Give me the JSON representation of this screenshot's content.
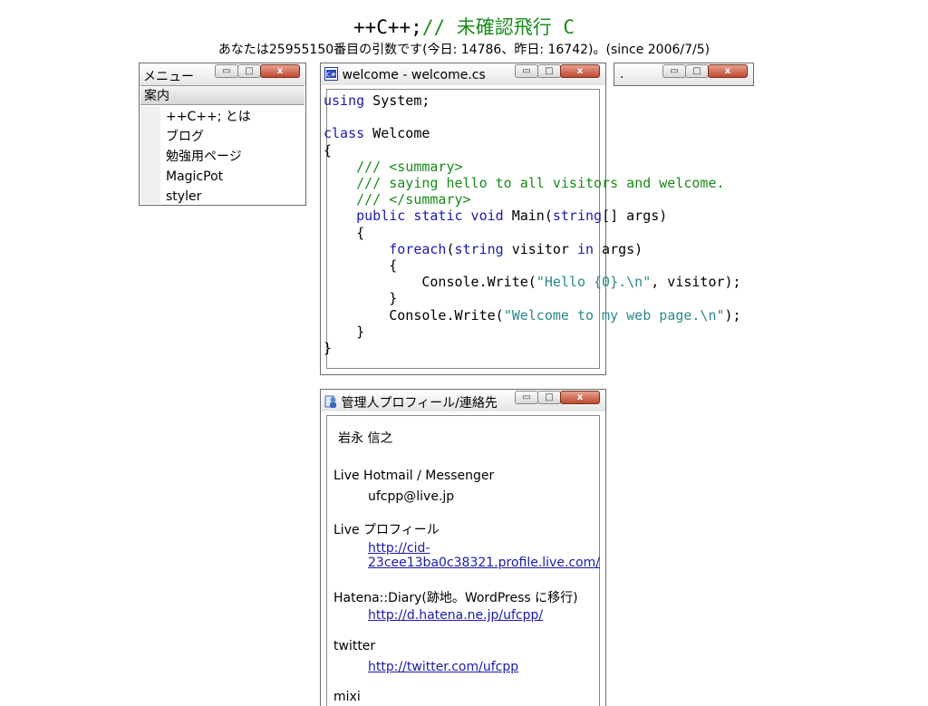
{
  "header": {
    "title_code": "++C++;",
    "title_comment": "// 未確認飛行 C",
    "counter": "あなたは25955150番目の引数です(今日: 14786、昨日: 16742)。(since 2006/7/5)"
  },
  "menu_window": {
    "title": "メニュー",
    "section": "案内",
    "items": [
      "++C++; とは",
      "ブログ",
      "勉強用ページ",
      "MagicPot",
      "styler"
    ]
  },
  "welcome_window": {
    "title": "welcome - welcome.cs",
    "code": [
      [
        [
          "kw",
          "using"
        ],
        [
          "tx",
          " System;"
        ]
      ],
      [],
      [
        [
          "kw",
          "class"
        ],
        [
          "tx",
          " Welcome"
        ]
      ],
      [
        [
          "tx",
          "{"
        ]
      ],
      [
        [
          "tx",
          "    "
        ],
        [
          "cm",
          "/// <summary>"
        ]
      ],
      [
        [
          "tx",
          "    "
        ],
        [
          "cm",
          "/// saying hello to all visitors and welcome."
        ]
      ],
      [
        [
          "tx",
          "    "
        ],
        [
          "cm",
          "/// </summary>"
        ]
      ],
      [
        [
          "tx",
          "    "
        ],
        [
          "kw",
          "public static void"
        ],
        [
          "tx",
          " Main("
        ],
        [
          "kw",
          "string"
        ],
        [
          "tx",
          "[] args)"
        ]
      ],
      [
        [
          "tx",
          "    {"
        ]
      ],
      [
        [
          "tx",
          "        "
        ],
        [
          "kw",
          "foreach"
        ],
        [
          "tx",
          "("
        ],
        [
          "kw",
          "string"
        ],
        [
          "tx",
          " visitor "
        ],
        [
          "kw",
          "in"
        ],
        [
          "tx",
          " args)"
        ]
      ],
      [
        [
          "tx",
          "        {"
        ]
      ],
      [
        [
          "tx",
          "            Console.Write("
        ],
        [
          "st",
          "\"Hello {0}.\\n\""
        ],
        [
          "tx",
          ", visitor);"
        ]
      ],
      [
        [
          "tx",
          "        }"
        ]
      ],
      [
        [
          "tx",
          "        Console.Write("
        ],
        [
          "st",
          "\"Welcome to my web page.\\n\""
        ],
        [
          "tx",
          ");"
        ]
      ],
      [
        [
          "tx",
          "    }"
        ]
      ],
      [
        [
          "tx",
          "}"
        ]
      ]
    ]
  },
  "small_window": {
    "title": "."
  },
  "profile_window": {
    "title": "管理人プロフィール/連絡先",
    "name": "岩永 信之",
    "hotmail_label": "Live Hotmail / Messenger",
    "hotmail_value": "ufcpp@live.jp",
    "live_profile_label": "Live プロフィール",
    "live_profile_link_line1": "http://cid-",
    "live_profile_link_line2": "23cee13ba0c38321.profile.live.com/",
    "hatena_label": "Hatena::Diary(跡地。WordPress に移行)",
    "hatena_link": "http://d.hatena.ne.jp/ufcpp/",
    "twitter_label": "twitter",
    "twitter_link": "http://twitter.com/ufcpp",
    "next_label": "mixi"
  },
  "window_buttons": {
    "minimize": "▭",
    "maximize": "□",
    "close": "x"
  },
  "colors": {
    "keyword": "#1a1aaa",
    "comment": "#1a8a1a",
    "string": "#2a8a8a",
    "link": "#1a1aaa"
  }
}
